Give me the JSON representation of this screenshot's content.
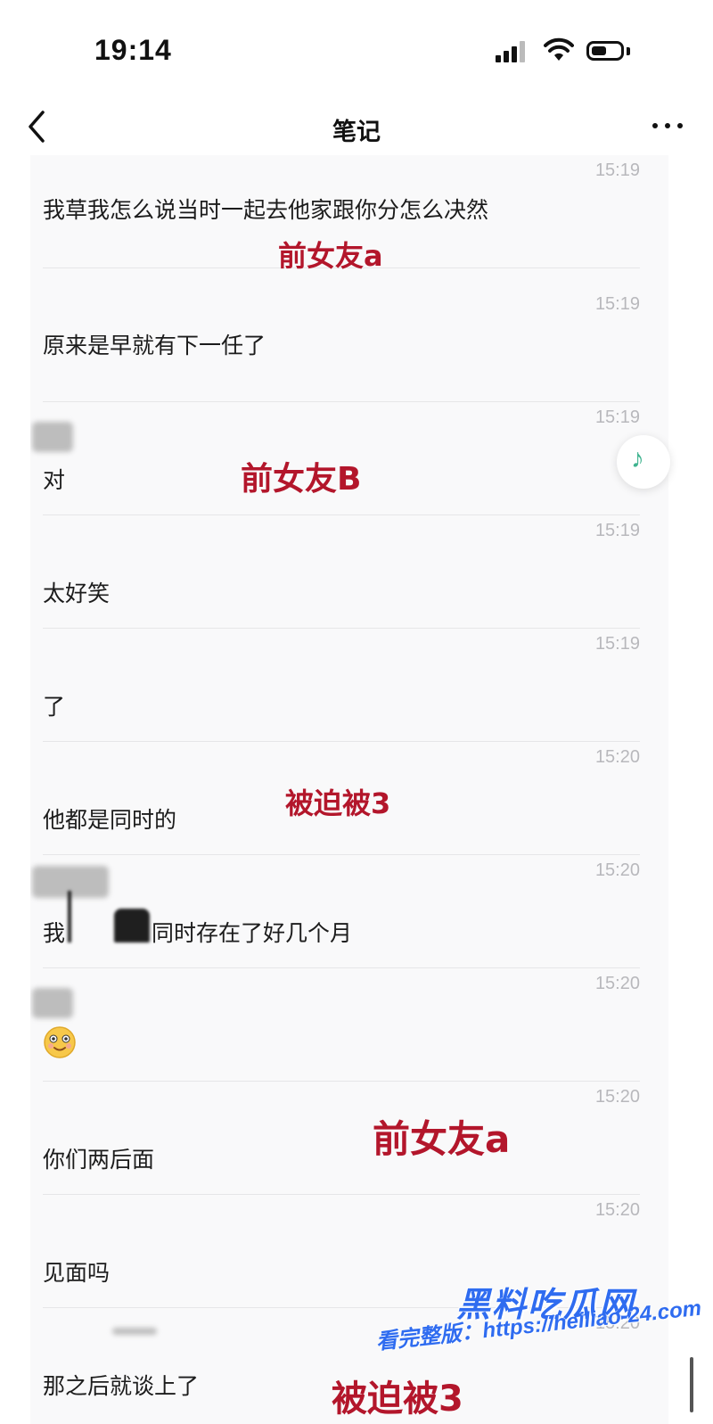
{
  "status_bar": {
    "time": "19:14"
  },
  "nav": {
    "title": "笔记"
  },
  "messages": [
    {
      "time": "15:19",
      "text": "我草我怎么说当时一起去他家跟你分怎么决然"
    },
    {
      "time": "15:19",
      "text": "原来是早就有下一任了"
    },
    {
      "time": "15:19",
      "text": "对"
    },
    {
      "time": "15:19",
      "text": "太好笑"
    },
    {
      "time": "15:19",
      "text": "了"
    },
    {
      "time": "15:20",
      "text": "他都是同时的"
    },
    {
      "time": "15:20",
      "text_a": "我",
      "text_b": "同时存在了好几个月"
    },
    {
      "time": "15:20",
      "text": ""
    },
    {
      "time": "15:20",
      "text": "你们两后面"
    },
    {
      "time": "15:20",
      "text": "见面吗"
    },
    {
      "time": "15:20",
      "text": "那之后就谈上了"
    }
  ],
  "annotations": {
    "a1": "前女友a",
    "b": "前女友B",
    "c1": "被迫被3",
    "a2": "前女友a",
    "c2": "被迫被3"
  },
  "watermark": {
    "logo": "黑料吃瓜网",
    "url": "看完整版：https://heiliao-24.com"
  },
  "colors": {
    "annotation": "#b3162b",
    "watermark": "#2f6cf0",
    "timestamp": "#b8b8bc",
    "music_icon": "#3fb38f"
  },
  "icons": [
    "back-chevron-icon",
    "more-dots-icon",
    "music-note-icon",
    "smiling-face-emoji-icon",
    "signal-icon",
    "wifi-icon",
    "battery-icon"
  ]
}
